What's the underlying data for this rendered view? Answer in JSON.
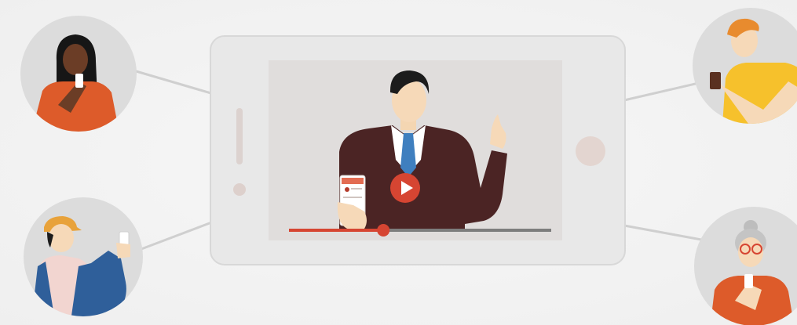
{
  "colors": {
    "background": "#f2f2f2",
    "phone_frame": "#e6e6e6",
    "phone_border": "#d6d6d6",
    "screen": "#e0dede",
    "avatar_circle": "#dcdcdc",
    "connector": "#cfcfcf",
    "accent_red": "#d64532",
    "suit": "#4a2323",
    "tie": "#3f7fbf",
    "skin": "#f6d9b8",
    "hair": "#1f1f1f",
    "orange": "#dd5b2a",
    "yellow": "#f6c12c",
    "blue": "#2f5f9a"
  },
  "video": {
    "play_button": "play-icon",
    "progress": 0.36
  },
  "viewers": [
    {
      "name": "viewer-top-left",
      "icon": "woman-phone-icon"
    },
    {
      "name": "viewer-bottom-left",
      "icon": "man-cap-phone-icon"
    },
    {
      "name": "viewer-top-right",
      "icon": "man-yellow-phone-icon"
    },
    {
      "name": "viewer-bottom-right",
      "icon": "elder-woman-phone-icon"
    }
  ]
}
